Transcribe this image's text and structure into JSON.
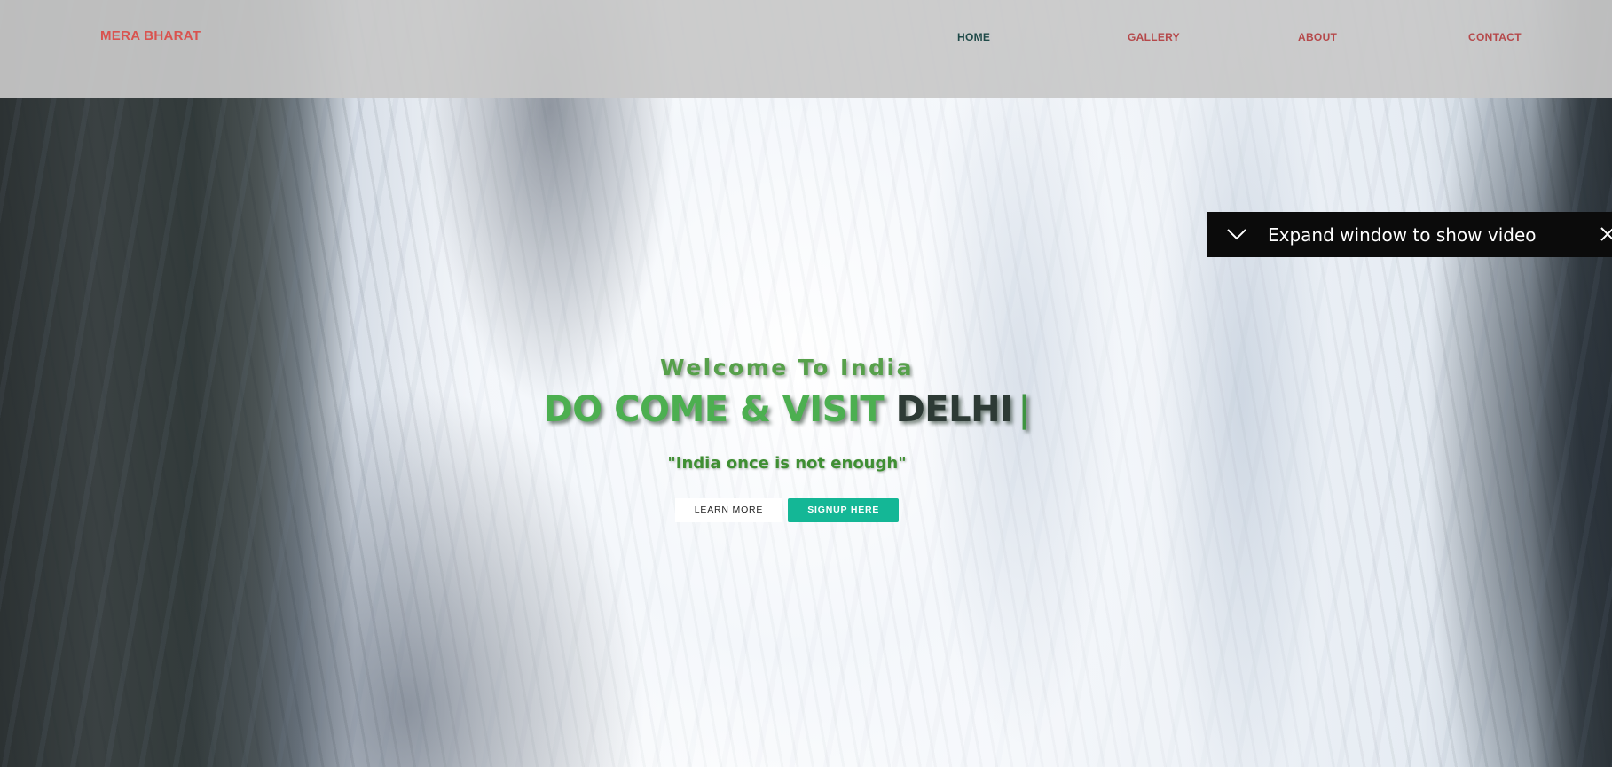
{
  "navbar": {
    "brand": "MERA BHARAT",
    "links": [
      {
        "label": "HOME",
        "active": true
      },
      {
        "label": "GALLERY",
        "active": false
      },
      {
        "label": "ABOUT",
        "active": false
      },
      {
        "label": "CONTACT",
        "active": false
      }
    ]
  },
  "video_popup": {
    "text": "Expand window to show video",
    "icons": [
      "chevron-down-icon",
      "close-icon"
    ]
  },
  "hero": {
    "welcome": "Welcome To India",
    "headline_prefix": "DO COME & VISIT",
    "headline_highlight": "DELHI",
    "headline_cursor": "|",
    "quote": "\"India once is not enough\"",
    "learn_more_label": "LEARN MORE",
    "signup_label": "SIGNUP HERE"
  },
  "colors": {
    "brand": "#d9534f",
    "nav_active": "#1f4a48",
    "nav_inactive": "#b5484a",
    "hero_green": "#4caf50",
    "hero_dark": "#2d3a35",
    "signup_bg": "#14b796",
    "navbar_bg": "#c8c8c8",
    "video_bar_bg": "#0b0b0b"
  }
}
